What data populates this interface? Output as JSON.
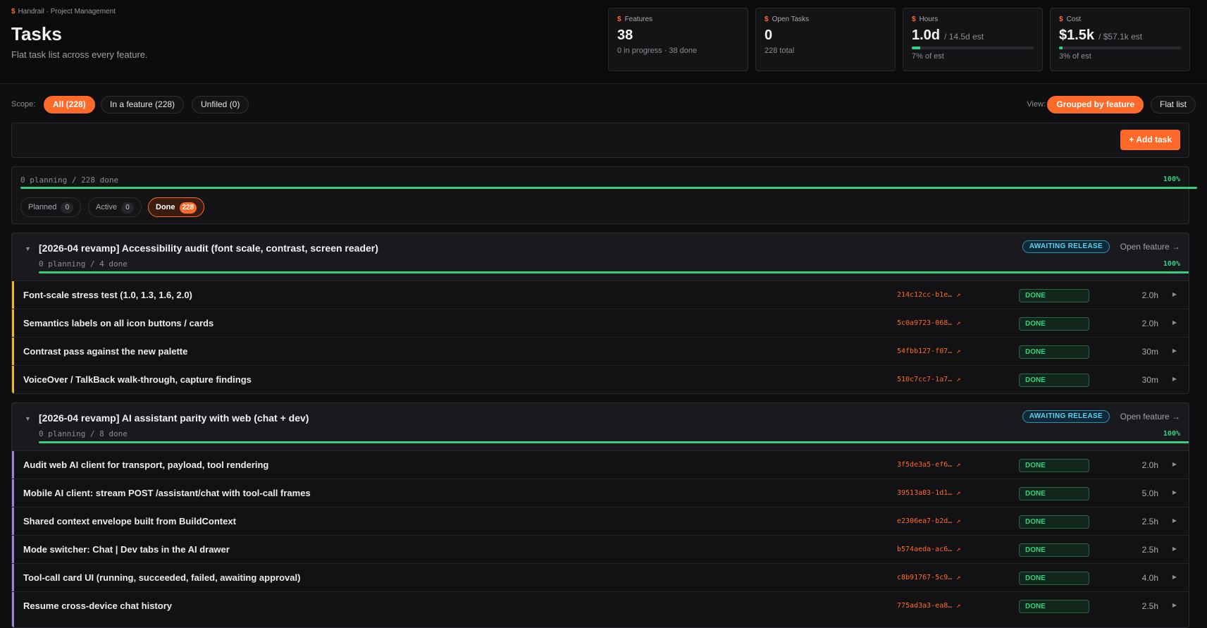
{
  "header": {
    "breadcrumb_prefix": "$",
    "breadcrumb": "Handrail · Project Management",
    "title": "Tasks",
    "subtitle": "Flat task list across every feature."
  },
  "stats": [
    {
      "icon": "$",
      "label": "Features",
      "value": "38",
      "est": "",
      "sub": "0 in progress · 38 done",
      "progress": null
    },
    {
      "icon": "$",
      "label": "Open Tasks",
      "value": "0",
      "est": "",
      "sub": "228 total",
      "progress": null
    },
    {
      "icon": "$",
      "label": "Hours",
      "value": "1.0d",
      "est": "/ 14.5d est",
      "sub": "7% of est",
      "progress": 0.07
    },
    {
      "icon": "$",
      "label": "Cost",
      "value": "$1.5k",
      "est": "/ $57.1k est",
      "sub": "3% of est",
      "progress": 0.03
    }
  ],
  "scope": {
    "label": "Scope:",
    "options": [
      "All (228)",
      "In a feature (228)",
      "Unfiled (0)"
    ],
    "selected": "All (228)"
  },
  "view": {
    "label": "View:",
    "options": [
      "Grouped by feature",
      "Flat list"
    ],
    "selected": "Grouped by feature"
  },
  "add_task_label": "+ Add task",
  "summary": {
    "text": "0 planning / 228 done",
    "percent": "100%",
    "progress": 1.0,
    "chips": [
      {
        "label": "Planned",
        "count": "0"
      },
      {
        "label": "Active",
        "count": "0"
      },
      {
        "label": "Done",
        "count": "228"
      }
    ],
    "selected_chip": "Done"
  },
  "colors": {
    "accent": "#ff6a2b",
    "success": "#35d07f",
    "feature_1_accent": "#f0b429",
    "feature_2_accent": "#9b7fe0"
  },
  "features": [
    {
      "title": "[2026-04 revamp] Accessibility audit (font scale, contrast, screen reader)",
      "sub": "0 planning / 4 done",
      "percent": "100%",
      "progress": 1.0,
      "badge": "AWAITING RELEASE",
      "open_label": "Open feature →",
      "tasks": [
        {
          "title": "Font-scale stress test (1.0, 1.3, 1.6, 2.0)",
          "id": "214c12cc-b1e… ↗",
          "status": "DONE",
          "hours": "2.0h"
        },
        {
          "title": "Semantics labels on all icon buttons / cards",
          "id": "5c0a9723-068… ↗",
          "status": "DONE",
          "hours": "2.0h"
        },
        {
          "title": "Contrast pass against the new palette",
          "id": "54fbb127-f07… ↗",
          "status": "DONE",
          "hours": "30m"
        },
        {
          "title": "VoiceOver / TalkBack walk-through, capture findings",
          "id": "510c7cc7-1a7… ↗",
          "status": "DONE",
          "hours": "30m"
        }
      ]
    },
    {
      "title": "[2026-04 revamp] AI assistant parity with web (chat + dev)",
      "sub": "0 planning / 8 done",
      "percent": "100%",
      "progress": 1.0,
      "badge": "AWAITING RELEASE",
      "open_label": "Open feature →",
      "tasks": [
        {
          "title": "Audit web AI client for transport, payload, tool rendering",
          "id": "3f5de3a5-ef6… ↗",
          "status": "DONE",
          "hours": "2.0h"
        },
        {
          "title": "Mobile AI client: stream POST /assistant/chat with tool-call frames",
          "id": "39513a83-1d1… ↗",
          "status": "DONE",
          "hours": "5.0h"
        },
        {
          "title": "Shared context envelope built from BuildContext",
          "id": "e2306ea7-b2d… ↗",
          "status": "DONE",
          "hours": "2.5h"
        },
        {
          "title": "Mode switcher: Chat | Dev tabs in the AI drawer",
          "id": "b574aeda-ac6… ↗",
          "status": "DONE",
          "hours": "2.5h"
        },
        {
          "title": "Tool-call card UI (running, succeeded, failed, awaiting approval)",
          "id": "c8b91767-5c9… ↗",
          "status": "DONE",
          "hours": "4.0h"
        },
        {
          "title": "Resume cross-device chat history",
          "id": "775ad3a3-ea8… ↗",
          "status": "DONE",
          "hours": "2.5h"
        }
      ]
    }
  ]
}
